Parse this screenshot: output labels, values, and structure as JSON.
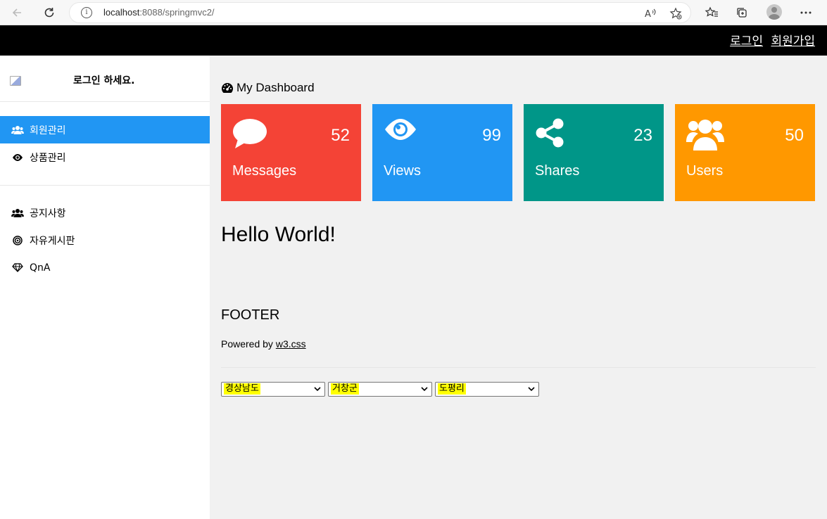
{
  "browser": {
    "url_host": "localhost",
    "url_rest": ":8088/springmvc2/"
  },
  "topbar": {
    "login": "로그인",
    "signup": "회원가입"
  },
  "sidebar": {
    "greeting": "로그인 하세요.",
    "menu_top": [
      {
        "label": "회원관리",
        "icon": "users-icon",
        "active": true
      },
      {
        "label": "상품관리",
        "icon": "eye-icon",
        "active": false
      }
    ],
    "menu_bottom": [
      {
        "label": "공지사항",
        "icon": "users-icon"
      },
      {
        "label": "자유게시판",
        "icon": "bullseye-icon"
      },
      {
        "label": "QnA",
        "icon": "diamond-icon"
      }
    ]
  },
  "dashboard": {
    "title": "My Dashboard",
    "cards": [
      {
        "label": "Messages",
        "value": "52",
        "color": "#f44336",
        "icon": "comment-icon"
      },
      {
        "label": "Views",
        "value": "99",
        "color": "#2196f3",
        "icon": "eye-icon"
      },
      {
        "label": "Shares",
        "value": "23",
        "color": "#009688",
        "icon": "share-icon"
      },
      {
        "label": "Users",
        "value": "50",
        "color": "#ff9800",
        "icon": "users-icon"
      }
    ]
  },
  "content": {
    "hello": "Hello World!"
  },
  "footer": {
    "title": "FOOTER",
    "powered_prefix": "Powered by ",
    "powered_link": "w3.css"
  },
  "selects": {
    "province": "경상남도",
    "county": "거창군",
    "village": "도평리"
  }
}
